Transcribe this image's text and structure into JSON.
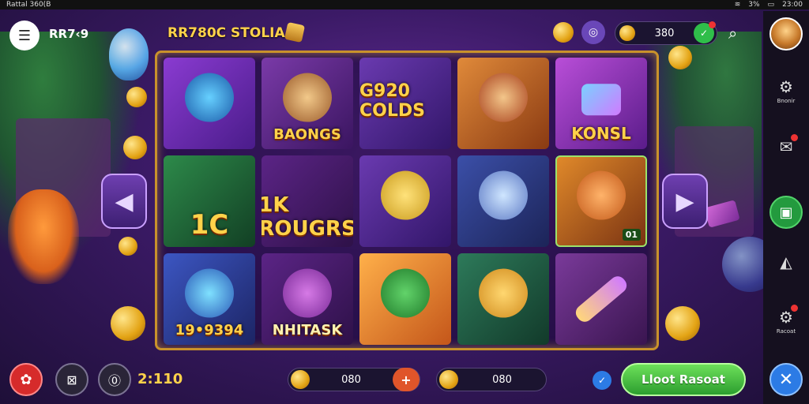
{
  "status_bar": {
    "left": "Rattal 360(B",
    "right_signal": "3%",
    "time": "23:00"
  },
  "header": {
    "brand": "RR7‹9",
    "title": "RR780C STOLIA",
    "balance": "380"
  },
  "reels": {
    "tiles": [
      {
        "label": "",
        "bg": "#6a2db0"
      },
      {
        "label": "BAONGS",
        "bg": "#5d2a86"
      },
      {
        "label": "G920 COLDS",
        "bg": "#5a2e9a"
      },
      {
        "label": "",
        "bg": "#b8652a"
      },
      {
        "label": "KONSL",
        "bg": "#8a39b8"
      },
      {
        "label": "1C",
        "bg": "#1e6a3a"
      },
      {
        "label": "1K ROUGRS",
        "bg": "#4b1f73"
      },
      {
        "label": "",
        "bg": "#5a2e9a"
      },
      {
        "label": "",
        "bg": "#2f3f8a"
      },
      {
        "label": "",
        "bg": "#b85a1c",
        "corner": "01"
      },
      {
        "label": "19•9394",
        "bg": "#2a3c8c"
      },
      {
        "label": "NHITASK",
        "bg": "#4b1f73"
      },
      {
        "label": "",
        "bg": "#d9741f"
      },
      {
        "label": "",
        "bg": "#246a4a"
      },
      {
        "label": "",
        "bg": "#6a2d8a"
      }
    ]
  },
  "rail": {
    "item1": "Bnonir",
    "item5": "Racoat"
  },
  "bottom": {
    "win_amount": "2:110",
    "bet_value": "080",
    "coin_value": "080",
    "cta_label": "Lloot Rasoat"
  }
}
